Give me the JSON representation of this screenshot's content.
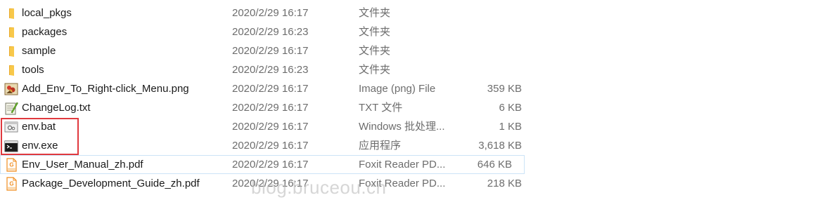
{
  "files": [
    {
      "name": "local_pkgs",
      "date": "2020/2/29 16:17",
      "type": "文件夹",
      "size": "",
      "icon": "folder-icon"
    },
    {
      "name": "packages",
      "date": "2020/2/29 16:23",
      "type": "文件夹",
      "size": "",
      "icon": "folder-icon"
    },
    {
      "name": "sample",
      "date": "2020/2/29 16:17",
      "type": "文件夹",
      "size": "",
      "icon": "folder-icon"
    },
    {
      "name": "tools",
      "date": "2020/2/29 16:23",
      "type": "文件夹",
      "size": "",
      "icon": "folder-icon"
    },
    {
      "name": "Add_Env_To_Right-click_Menu.png",
      "date": "2020/2/29 16:17",
      "type": "Image (png) File",
      "size": "359 KB",
      "icon": "image-file-icon"
    },
    {
      "name": "ChangeLog.txt",
      "date": "2020/2/29 16:17",
      "type": "TXT 文件",
      "size": "6 KB",
      "icon": "text-file-icon"
    },
    {
      "name": "env.bat",
      "date": "2020/2/29 16:17",
      "type": "Windows 批处理...",
      "size": "1 KB",
      "icon": "batch-file-icon"
    },
    {
      "name": "env.exe",
      "date": "2020/2/29 16:17",
      "type": "应用程序",
      "size": "3,618 KB",
      "icon": "console-app-icon"
    },
    {
      "name": "Env_User_Manual_zh.pdf",
      "date": "2020/2/29 16:17",
      "type": "Foxit Reader PD...",
      "size": "646 KB",
      "icon": "pdf-file-icon"
    },
    {
      "name": "Package_Development_Guide_zh.pdf",
      "date": "2020/2/29 16:17",
      "type": "Foxit Reader PD...",
      "size": "218 KB",
      "icon": "pdf-file-icon"
    }
  ],
  "watermark": "blog.bruceou.cn",
  "colors": {
    "highlight_border": "#e0393e",
    "hover_outline": "#cce4f7",
    "folder_yellow": "#f8c84a",
    "pdf_orange": "#f08c1e"
  }
}
